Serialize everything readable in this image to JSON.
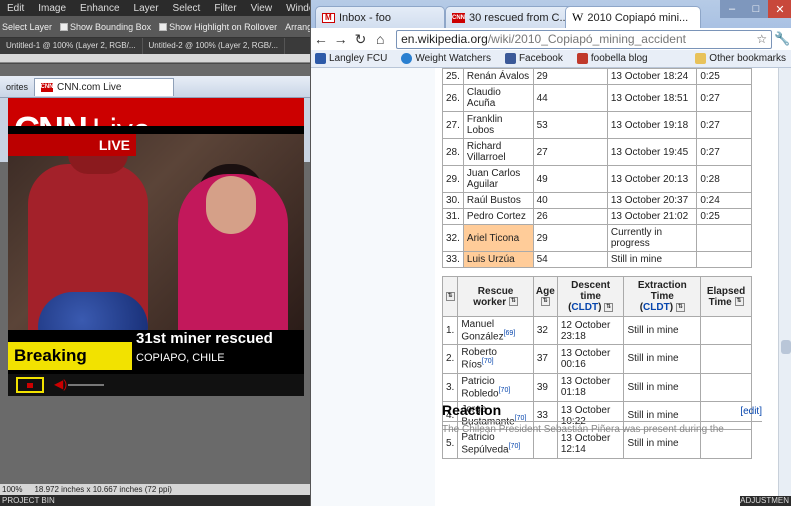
{
  "editor": {
    "menu": [
      "Edit",
      "Image",
      "Enhance",
      "Layer",
      "Select",
      "Filter",
      "View",
      "Window"
    ],
    "options": [
      "Select Layer",
      "Show Bounding Box",
      "Show Highlight on Rollover",
      "Arrange"
    ],
    "doc_tabs": [
      "Untitled-1 @ 100% (Layer 2, RGB/...",
      "Untitled-2 @ 100% (Layer 2, RGB/..."
    ],
    "status": "18.972 inches x 10.667 inches (72 ppi)",
    "zoom": "100%",
    "project_bin": "PROJECT BIN",
    "adjustments": "ADJUSTMEN"
  },
  "ie": {
    "favorites": "orites",
    "tab_title": "CNN.com Live"
  },
  "cnn": {
    "logo": "CNN",
    "live_word": "Live",
    "live_badge": "LIVE",
    "breaking": "Breaking news",
    "headline": "31st miner rescued",
    "location": "COPIAPO, CHILE"
  },
  "chrome": {
    "tabs": [
      {
        "label": "Inbox - foo"
      },
      {
        "label": "30 rescued from C..."
      },
      {
        "label": "2010 Copiapó mini..."
      }
    ],
    "url_host": "en.wikipedia.org",
    "url_path": "/wiki/2010_Copiapó_mining_accident",
    "bookmarks": [
      "Langley FCU",
      "Weight Watchers",
      "Facebook",
      "foobella blog"
    ],
    "other_bookmarks": "Other bookmarks"
  },
  "miners": [
    {
      "num": "25.",
      "name": "Renán Ávalos",
      "age": "29",
      "descent": "13 October 18:24",
      "extract": "0:25",
      "hl": ""
    },
    {
      "num": "26.",
      "name": "Claudio Acuña",
      "age": "44",
      "descent": "13 October 18:51",
      "extract": "0:27",
      "hl": ""
    },
    {
      "num": "27.",
      "name": "Franklin Lobos",
      "age": "53",
      "descent": "13 October 19:18",
      "extract": "0:27",
      "hl": ""
    },
    {
      "num": "28.",
      "name": "Richard Villarroel",
      "age": "27",
      "descent": "13 October 19:45",
      "extract": "0:27",
      "hl": ""
    },
    {
      "num": "29.",
      "name": "Juan Carlos Aguilar",
      "age": "49",
      "descent": "13 October 20:13",
      "extract": "0:28",
      "hl": ""
    },
    {
      "num": "30.",
      "name": "Raúl Bustos",
      "age": "40",
      "descent": "13 October 20:37",
      "extract": "0:24",
      "hl": ""
    },
    {
      "num": "31.",
      "name": "Pedro Cortez",
      "age": "26",
      "descent": "13 October 21:02",
      "extract": "0:25",
      "hl": ""
    },
    {
      "num": "32.",
      "name": "Ariel Ticona",
      "age": "29",
      "descent": "Currently in progress",
      "extract": "",
      "hl": "orange"
    },
    {
      "num": "33.",
      "name": "Luis Urzúa",
      "age": "54",
      "descent": "Still in mine",
      "extract": "",
      "hl": "orange"
    }
  ],
  "rescue_headers": {
    "worker": "Rescue worker",
    "age": "Age",
    "descent": "Descent time",
    "extraction": "Extraction Time",
    "elapsed": "Elapsed Time",
    "cldt": "CLDT"
  },
  "rescuers": [
    {
      "num": "1.",
      "name": "Manuel González",
      "ref": "[69]",
      "age": "32",
      "descent": "12 October 23:18",
      "extract": "Still in mine"
    },
    {
      "num": "2.",
      "name": "Roberto Ríos",
      "ref": "[70]",
      "age": "37",
      "descent": "13 October 00:16",
      "extract": "Still in mine"
    },
    {
      "num": "3.",
      "name": "Patricio Robledo",
      "ref": "[70]",
      "age": "39",
      "descent": "13 October 01:18",
      "extract": "Still in mine"
    },
    {
      "num": "4.",
      "name": "Jorge Bustamante",
      "ref": "[70]",
      "age": "33",
      "descent": "13 October 10:22",
      "extract": "Still in mine"
    },
    {
      "num": "5.",
      "name": "Patricio Sepúlveda",
      "ref": "[70]",
      "age": "",
      "descent": "13 October 12:14",
      "extract": "Still in mine"
    }
  ],
  "reaction": {
    "heading": "Reaction",
    "edit": "[edit]",
    "snippet": "The Chilean President Sebastián Piñera was present during the"
  }
}
